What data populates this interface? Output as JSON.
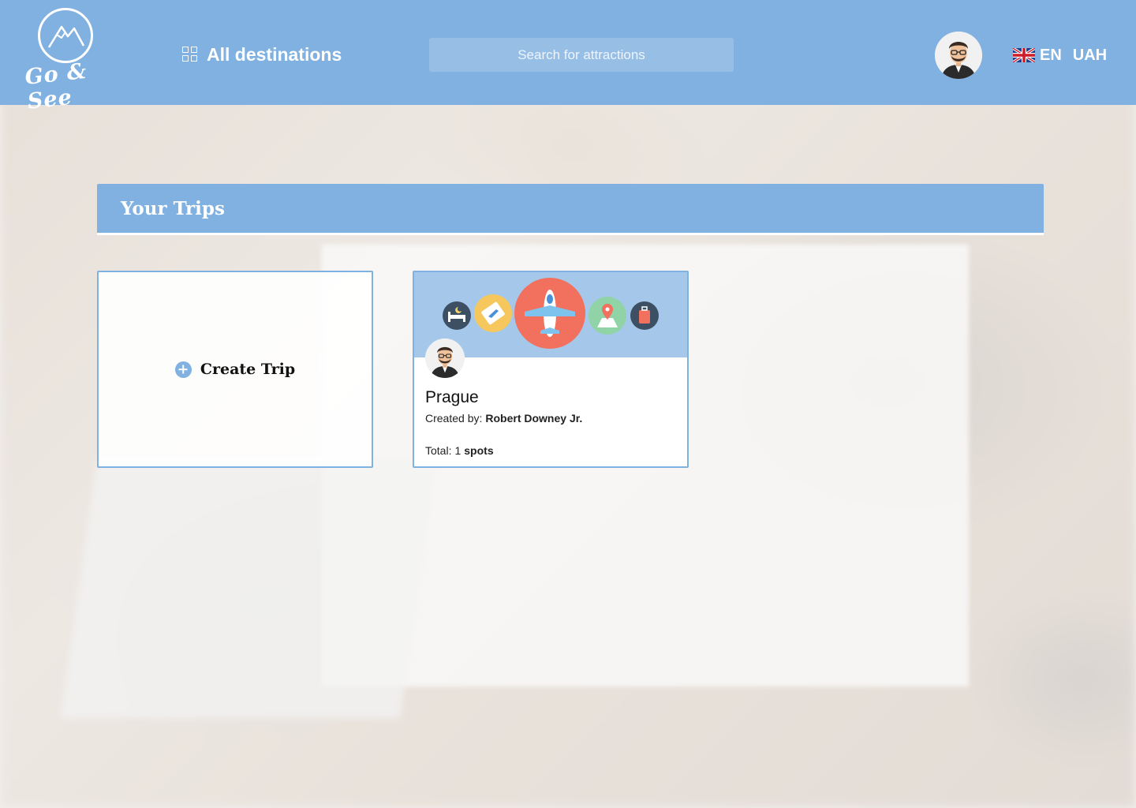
{
  "header": {
    "logo_text": "Go & See",
    "nav_label": "All destinations",
    "search_placeholder": "Search for attractions",
    "language": "EN",
    "currency": "UAH"
  },
  "trips": {
    "title": "Your Trips",
    "create_label": "Create Trip",
    "items": [
      {
        "name": "Prague",
        "created_by_label": "Created by:",
        "creator": "Robert Downey Jr.",
        "total_label": "Total:",
        "spots_count": "1",
        "spots_label": "spots"
      }
    ]
  },
  "colors": {
    "accent": "#80b1e1",
    "banner": "#a5c8ea"
  },
  "icons": [
    "grid-icon",
    "uk-flag-icon",
    "plus-icon",
    "bed-icon",
    "ticket-icon",
    "airplane-icon",
    "map-pin-icon",
    "suitcase-icon",
    "mountain-logo-icon"
  ]
}
